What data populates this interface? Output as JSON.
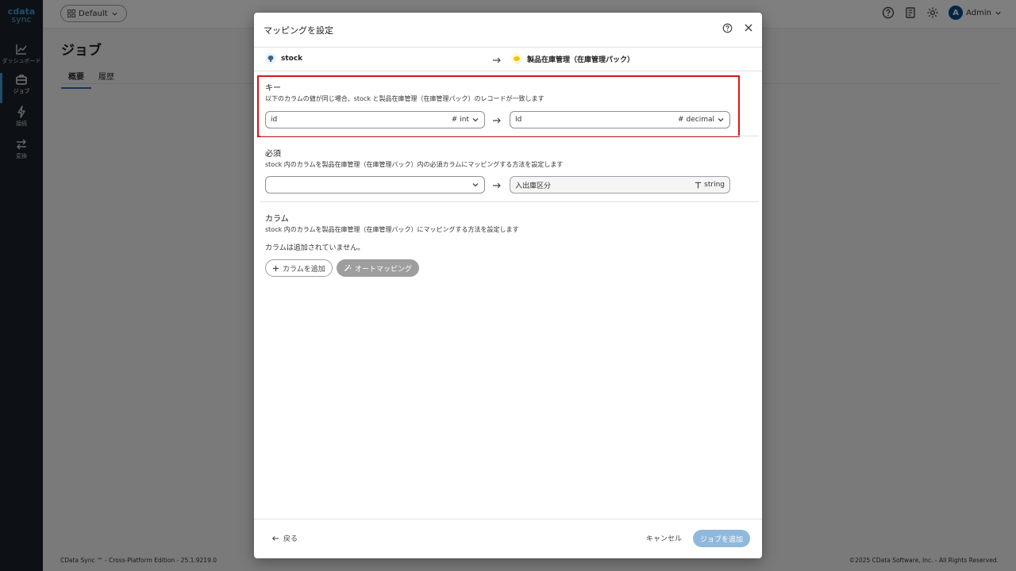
{
  "app": {
    "logo_line1": "cdata",
    "logo_line2": "sync",
    "workspace": "Default",
    "user_initial": "A",
    "user_name": "Admin"
  },
  "sidebar": {
    "items": [
      {
        "label": "ダッシュボード",
        "icon": "chart-line-icon"
      },
      {
        "label": "ジョブ",
        "icon": "briefcase-icon"
      },
      {
        "label": "接続",
        "icon": "plug-icon"
      },
      {
        "label": "変換",
        "icon": "transform-arrows-icon"
      }
    ]
  },
  "page": {
    "title": "ジョブ",
    "tabs": [
      "概要",
      "履歴"
    ]
  },
  "footer": {
    "left": "CData Sync ™ - Cross-Platform Edition - 25.1.9219.0",
    "right": "©2025 CData Software, Inc. - All Rights Reserved."
  },
  "dialog": {
    "title": "マッピングを設定",
    "source_name": "stock",
    "dest_name": "製品在庫管理（在庫管理パック）",
    "key": {
      "title": "キー",
      "desc": "以下のカラムの値が同じ場合、stock と製品在庫管理（在庫管理パック）のレコードが一致します",
      "source_value": "id",
      "source_type": "int",
      "dest_value": "Id",
      "dest_type": "decimal"
    },
    "required": {
      "title": "必須",
      "desc": "stock 内のカラムを製品在庫管理（在庫管理パック）内の必須カラムにマッピングする方法を設定します",
      "source_value": "",
      "dest_value": "入出庫区分",
      "dest_type": "string"
    },
    "columns": {
      "title": "カラム",
      "desc": "stock 内のカラムを製品在庫管理（在庫管理パック）にマッピングする方法を設定します",
      "empty_message": "カラムは追加されていません。",
      "add_label": "カラムを追加",
      "auto_label": "オートマッピング"
    },
    "footer": {
      "back_label": "戻る",
      "cancel_label": "キャンセル",
      "submit_label": "ジョブを追加"
    }
  },
  "colors": {
    "sidebar_bg": "#1b2128",
    "accent": "#2a6fb3",
    "highlight_border": "#d6161a",
    "primary_disabled": "#8fb9dc"
  }
}
